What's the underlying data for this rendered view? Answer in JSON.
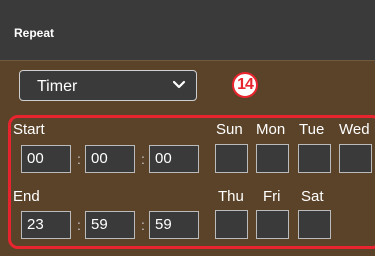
{
  "header": {
    "title": "Repeat"
  },
  "mode_select": {
    "value": "Timer",
    "icon": "chevron-down-icon"
  },
  "annotation": {
    "number": "14",
    "color": "#e8242e"
  },
  "schedule": {
    "start": {
      "label": "Start",
      "hours": "00",
      "minutes": "00",
      "seconds": "00"
    },
    "end": {
      "label": "End",
      "hours": "23",
      "minutes": "59",
      "seconds": "59"
    },
    "separator": ":",
    "days_row1": [
      "Sun",
      "Mon",
      "Tue",
      "Wed"
    ],
    "days_row2": [
      "Thu",
      "Fri",
      "Sat"
    ]
  }
}
